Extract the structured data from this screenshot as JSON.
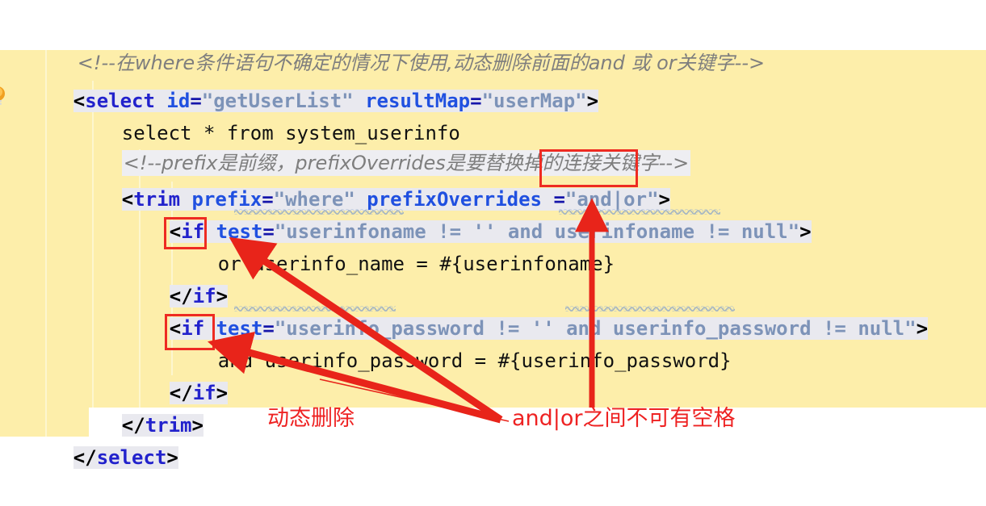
{
  "app": {
    "kind": "code-editor-screenshot",
    "language": "xml",
    "editor_background": "#fdeeaa",
    "tag_highlight": "#e9e9ef",
    "annotation_color": "#ee2222"
  },
  "icons": {
    "intention_bulb": "lightbulb-icon"
  },
  "code": {
    "lines": [
      {
        "id": "l1",
        "indent": 0,
        "type": "comment",
        "text": "<!--在where条件语句不确定的情况下使用,动态删除前面的and 或 or关键字-->"
      },
      {
        "id": "l2",
        "indent": 0,
        "type": "tag-open",
        "tokens": [
          {
            "t": "<",
            "c": "punct"
          },
          {
            "t": "select",
            "c": "tagname"
          },
          {
            "t": " ",
            "c": "plain"
          },
          {
            "t": "id",
            "c": "attr"
          },
          {
            "t": "=",
            "c": "eq"
          },
          {
            "t": "\"getUserList\"",
            "c": "aval"
          },
          {
            "t": " ",
            "c": "plain"
          },
          {
            "t": "resultMap",
            "c": "attr"
          },
          {
            "t": "=",
            "c": "eq"
          },
          {
            "t": "\"userMap\"",
            "c": "aval"
          },
          {
            "t": ">",
            "c": "punct"
          }
        ]
      },
      {
        "id": "l3",
        "indent": 1,
        "type": "text",
        "tokens": [
          {
            "t": "select * from system_userinfo",
            "c": "plain"
          }
        ]
      },
      {
        "id": "l4",
        "indent": 1,
        "type": "comment",
        "text": "<!--prefix是前缀，prefixOverrides是要替换掉的连接关键字-->"
      },
      {
        "id": "l5",
        "indent": 1,
        "type": "tag-open",
        "tokens": [
          {
            "t": "<",
            "c": "punct"
          },
          {
            "t": "trim",
            "c": "tagname"
          },
          {
            "t": " ",
            "c": "plain"
          },
          {
            "t": "prefix",
            "c": "attr"
          },
          {
            "t": "=",
            "c": "eq"
          },
          {
            "t": "\"where\"",
            "c": "aval"
          },
          {
            "t": " ",
            "c": "plain"
          },
          {
            "t": "prefixOverrides",
            "c": "attr"
          },
          {
            "t": " =",
            "c": "eq"
          },
          {
            "t": "\"and|or\"",
            "c": "aval"
          },
          {
            "t": ">",
            "c": "punct"
          }
        ]
      },
      {
        "id": "l6",
        "indent": 2,
        "type": "tag-open",
        "tokens": [
          {
            "t": "<",
            "c": "punct"
          },
          {
            "t": "if",
            "c": "tagname"
          },
          {
            "t": " ",
            "c": "plain"
          },
          {
            "t": "test",
            "c": "attr"
          },
          {
            "t": "=",
            "c": "eq"
          },
          {
            "t": "\"userinfoname != '' and userinfoname != null\"",
            "c": "aval"
          },
          {
            "t": ">",
            "c": "punct"
          }
        ]
      },
      {
        "id": "l7",
        "indent": 3,
        "type": "text",
        "tokens": [
          {
            "t": "or userinfo_name = #{userinfoname}",
            "c": "plain"
          }
        ]
      },
      {
        "id": "l8",
        "indent": 2,
        "type": "tag-close",
        "tokens": [
          {
            "t": "</",
            "c": "punct"
          },
          {
            "t": "if",
            "c": "tagname"
          },
          {
            "t": ">",
            "c": "punct"
          }
        ]
      },
      {
        "id": "l9",
        "indent": 2,
        "type": "tag-open",
        "tokens": [
          {
            "t": "<",
            "c": "punct"
          },
          {
            "t": "if",
            "c": "tagname"
          },
          {
            "t": " ",
            "c": "plain"
          },
          {
            "t": "test",
            "c": "attr"
          },
          {
            "t": "=",
            "c": "eq"
          },
          {
            "t": "\"userinfo_password != '' and userinfo_password != null\"",
            "c": "aval"
          },
          {
            "t": ">",
            "c": "punct"
          }
        ]
      },
      {
        "id": "l10",
        "indent": 3,
        "type": "text",
        "tokens": [
          {
            "t": "and userinfo_password = #{userinfo_password}",
            "c": "plain"
          }
        ]
      },
      {
        "id": "l11",
        "indent": 2,
        "type": "tag-close",
        "tokens": [
          {
            "t": "</",
            "c": "punct"
          },
          {
            "t": "if",
            "c": "tagname"
          },
          {
            "t": ">",
            "c": "punct"
          }
        ]
      },
      {
        "id": "l12",
        "indent": 1,
        "type": "tag-close",
        "tokens": [
          {
            "t": "</",
            "c": "punct"
          },
          {
            "t": "trim",
            "c": "tagname"
          },
          {
            "t": ">",
            "c": "punct"
          }
        ]
      },
      {
        "id": "l13",
        "indent": 0,
        "type": "tag-close",
        "tokens": [
          {
            "t": "</",
            "c": "punct"
          },
          {
            "t": "select",
            "c": "tagname"
          },
          {
            "t": ">",
            "c": "punct"
          }
        ]
      }
    ]
  },
  "annotations": {
    "boxes": [
      {
        "id": "box-andor",
        "target": "and|or attribute value"
      },
      {
        "id": "box-or",
        "target": "or keyword"
      },
      {
        "id": "box-and",
        "target": "and keyword"
      }
    ],
    "labels": {
      "dynamic_delete": "动态删除",
      "no_space": "and|or之间不可有空格"
    }
  }
}
